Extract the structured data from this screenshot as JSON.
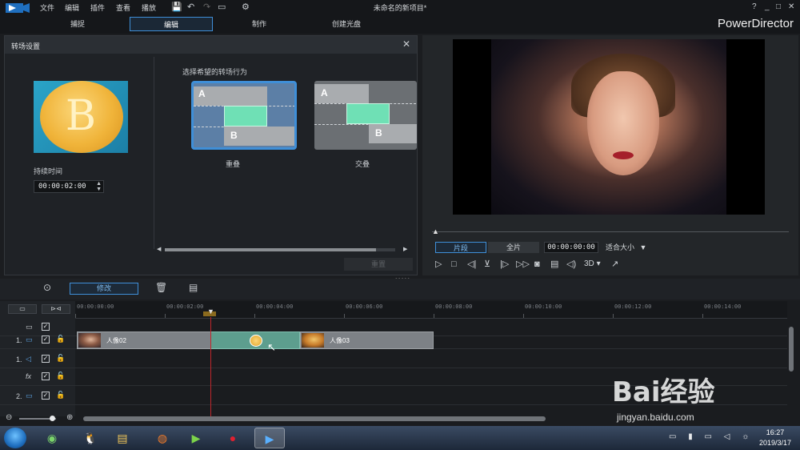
{
  "menubar": {
    "items": [
      "文件",
      "编辑",
      "插件",
      "查看",
      "播放"
    ],
    "app_title": "未命名的新项目*",
    "window_buttons": [
      "?",
      "_",
      "□",
      "✕"
    ]
  },
  "modes": {
    "tabs": [
      "捕捉",
      "编辑",
      "制作",
      "创建光盘"
    ],
    "active": "编辑",
    "brand": "PowerDirector"
  },
  "transition_panel": {
    "title": "转场设置",
    "duration_label": "持续时间",
    "duration_value": "00:00:02:00",
    "behavior_label": "选择希望的转场行为",
    "options": [
      {
        "label": "重叠",
        "selected": true,
        "letter_a": "A",
        "letter_b": "B"
      },
      {
        "label": "交叠",
        "selected": false,
        "letter_a": "A",
        "letter_b": "B"
      }
    ],
    "apply_label": "重置",
    "thumb_letter": "B"
  },
  "preview": {
    "segment_label": "片段",
    "full_label": "全片",
    "timecode": "00:00:00:00",
    "fit_label": "适合大小",
    "three_d_label": "3D"
  },
  "toolbar": {
    "modify_label": "修改"
  },
  "timeline": {
    "ruler": [
      "00:00:00:00",
      "00:00:02:00",
      "00:00:04:00",
      "00:00:06:00",
      "00:00:08:00",
      "00:00:10:00",
      "00:00:12:00",
      "00:00:14:00"
    ],
    "tracks": [
      {
        "num": "",
        "type": "video"
      },
      {
        "num": "1.",
        "type": "video"
      },
      {
        "num": "1.",
        "type": "audio"
      },
      {
        "num": "",
        "type": "fx"
      },
      {
        "num": "2.",
        "type": "video"
      }
    ],
    "fx_label": "fx",
    "clips": [
      {
        "label": "人像02"
      },
      {
        "label": "人像03"
      }
    ]
  },
  "taskbar": {
    "time": "16:27",
    "date": "2019/3/17"
  },
  "watermark": {
    "logo": "Bai经验",
    "url": "jingyan.baidu.com"
  },
  "colors": {
    "accent": "#3f8fd8",
    "transition_green": "#6fe0b5",
    "playhead": "#c0262b"
  }
}
